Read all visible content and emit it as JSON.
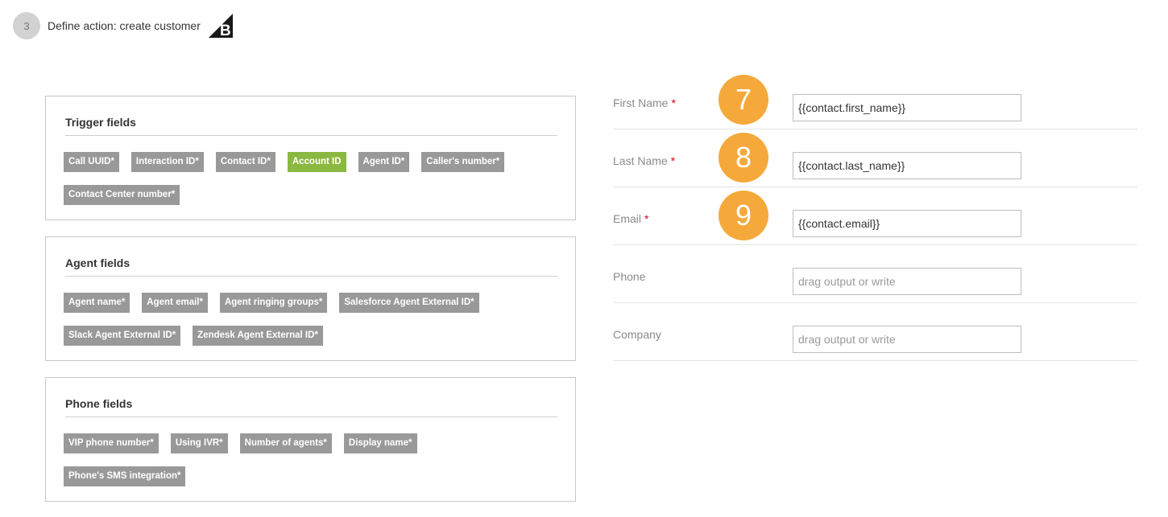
{
  "header": {
    "step_number": "3",
    "title": "Define action: create customer",
    "logo_icon": "bigcommerce-logo-icon"
  },
  "colors": {
    "tag_gray": "#999999",
    "tag_active": "#8bb840",
    "badge_orange": "#f5a93b",
    "required_red": "#d0021b"
  },
  "panels": [
    {
      "title": "Trigger fields",
      "tags": [
        {
          "label": "Call UUID*",
          "active": false
        },
        {
          "label": "Interaction ID*",
          "active": false
        },
        {
          "label": "Contact ID*",
          "active": false
        },
        {
          "label": "Account ID",
          "active": true
        },
        {
          "label": "Agent ID*",
          "active": false
        },
        {
          "label": "Caller's number*",
          "active": false
        },
        {
          "label": "Contact Center number*",
          "active": false
        }
      ]
    },
    {
      "title": "Agent fields",
      "tags": [
        {
          "label": "Agent name*",
          "active": false
        },
        {
          "label": "Agent email*",
          "active": false
        },
        {
          "label": "Agent ringing groups*",
          "active": false
        },
        {
          "label": "Salesforce Agent External ID*",
          "active": false
        },
        {
          "label": "Slack Agent External ID*",
          "active": false
        },
        {
          "label": "Zendesk Agent External ID*",
          "active": false
        }
      ]
    },
    {
      "title": "Phone fields",
      "tags": [
        {
          "label": "VIP phone number*",
          "active": false
        },
        {
          "label": "Using IVR*",
          "active": false
        },
        {
          "label": "Number of agents*",
          "active": false
        },
        {
          "label": "Display name*",
          "active": false
        },
        {
          "label": "Phone's SMS integration*",
          "active": false
        }
      ]
    }
  ],
  "form": {
    "rows": [
      {
        "label": "First Name",
        "required": "*",
        "value": "{{contact.first_name}}",
        "placeholder": "",
        "badge": "7"
      },
      {
        "label": "Last Name",
        "required": "*",
        "value": "{{contact.last_name}}",
        "placeholder": "",
        "badge": "8"
      },
      {
        "label": "Email",
        "required": "*",
        "value": "{{contact.email}}",
        "placeholder": "",
        "badge": "9"
      },
      {
        "label": "Phone",
        "required": "",
        "value": "",
        "placeholder": "drag output or write",
        "badge": ""
      },
      {
        "label": "Company",
        "required": "",
        "value": "",
        "placeholder": "drag output or write",
        "badge": ""
      }
    ]
  }
}
